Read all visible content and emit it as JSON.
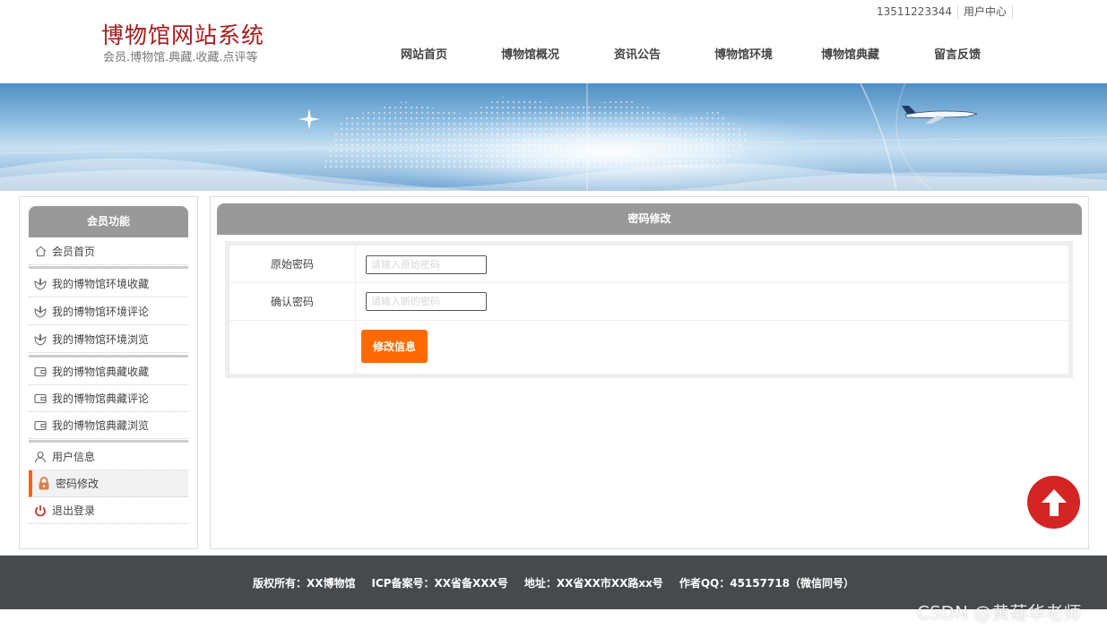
{
  "header": {
    "site_title": "博物馆网站系统",
    "site_subtitle": "会员.博物馆.典藏.收藏.点评等",
    "phone": "13511223344",
    "user_center": "用户中心",
    "nav": [
      "网站首页",
      "博物馆概况",
      "资讯公告",
      "博物馆环境",
      "博物馆典藏",
      "留言反馈"
    ]
  },
  "sidebar": {
    "title": "会员功能",
    "items": [
      {
        "label": "会员首页",
        "icon": "home-icon"
      },
      {
        "label": "我的博物馆环境收藏",
        "icon": "flower-icon"
      },
      {
        "label": "我的博物馆环境评论",
        "icon": "flower-icon"
      },
      {
        "label": "我的博物馆环境浏览",
        "icon": "flower-icon"
      },
      {
        "label": "我的博物馆典藏收藏",
        "icon": "wallet-icon"
      },
      {
        "label": "我的博物馆典藏评论",
        "icon": "wallet-icon"
      },
      {
        "label": "我的博物馆典藏浏览",
        "icon": "wallet-icon"
      },
      {
        "label": "用户信息",
        "icon": "user-icon"
      },
      {
        "label": "密码修改",
        "icon": "lock-icon",
        "active": true
      },
      {
        "label": "退出登录",
        "icon": "power-icon"
      }
    ]
  },
  "main": {
    "title": "密码修改",
    "form": {
      "old_password_label": "原始密码",
      "old_password_placeholder": "请输入原始密码",
      "old_password_value": "",
      "confirm_password_label": "确认密码",
      "confirm_password_placeholder": "请输入新的密码",
      "confirm_password_value": "",
      "submit_label": "修改信息"
    }
  },
  "footer": {
    "copyright": "版权所有：XX博物馆",
    "icp": "ICP备案号：XX省备XXX号",
    "address": "地址：XX省XX市XX路xx号",
    "qq": "作者QQ：45157718（微信同号）"
  },
  "watermark": "CSDN @黄菊华老师",
  "colors": {
    "accent": "#ff6a00",
    "title_red": "#a61c1c",
    "panel_head": "#999999",
    "footer_bg": "#464a4d",
    "back_to_top": "#d42424"
  }
}
